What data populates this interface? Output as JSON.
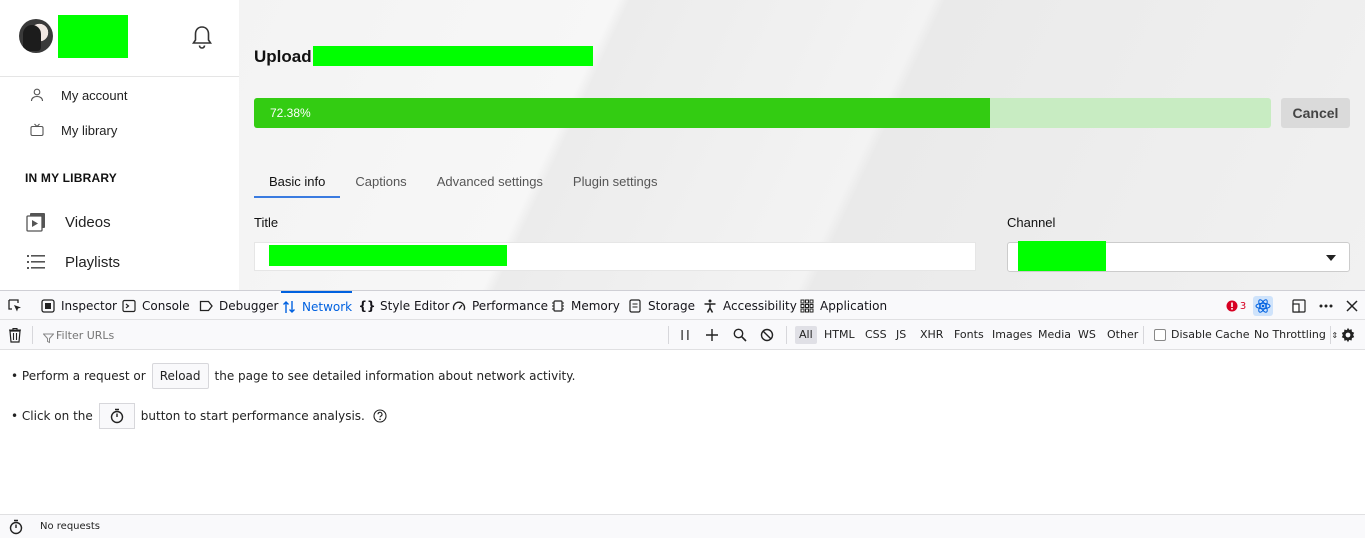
{
  "sidebar": {
    "menu": [
      {
        "label": "My account",
        "icon": "user-icon"
      },
      {
        "label": "My library",
        "icon": "tv-icon"
      }
    ],
    "section_title": "IN MY LIBRARY",
    "library": [
      {
        "label": "Videos",
        "icon": "video-play-icon"
      },
      {
        "label": "Playlists",
        "icon": "list-icon"
      }
    ]
  },
  "main": {
    "upload_title": "Upload",
    "progress": {
      "percent_text": "72.38%",
      "value": 72.38,
      "color": "#33cc12",
      "track_color": "#c8ecc2"
    },
    "cancel_label": "Cancel",
    "tabs": [
      "Basic info",
      "Captions",
      "Advanced settings",
      "Plugin settings"
    ],
    "active_tab": "Basic info",
    "title_label": "Title",
    "channel_label": "Channel"
  },
  "devtools": {
    "tabs": [
      "Inspector",
      "Console",
      "Debugger",
      "Network",
      "Style Editor",
      "Performance",
      "Memory",
      "Storage",
      "Accessibility",
      "Application"
    ],
    "active_tab": "Network",
    "error_count": "3",
    "filter_placeholder": "Filter URLs",
    "filter_types": [
      "All",
      "HTML",
      "CSS",
      "JS",
      "XHR",
      "Fonts",
      "Images",
      "Media",
      "WS",
      "Other"
    ],
    "selected_filter": "All",
    "disable_cache_label": "Disable Cache",
    "throttling_label": "No Throttling",
    "msg1_before": "• Perform a request or",
    "reload_label": "Reload",
    "msg1_after": "the page to see detailed information about network activity.",
    "msg2_before": "• Click on the",
    "msg2_after": "button to start performance analysis.",
    "status": "No requests",
    "accent_color": "#0061e0"
  }
}
